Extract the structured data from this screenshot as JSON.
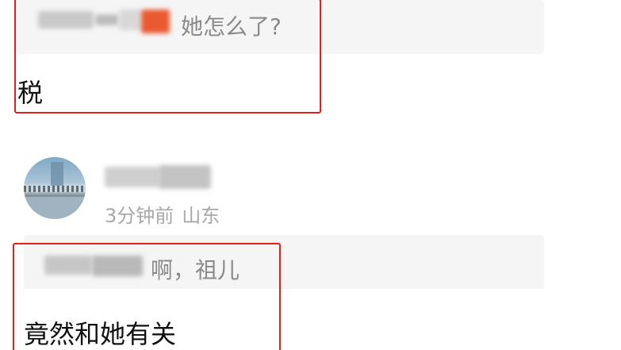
{
  "comments": [
    {
      "quote": {
        "author_name": "",
        "text": "她怎么了?"
      },
      "body": "税"
    },
    {
      "author": {
        "username": "",
        "time_ago": "3分钟前",
        "location": "山东",
        "avatar": "avatar-icon"
      },
      "quote": {
        "author_name": "",
        "text": "啊，祖儿"
      },
      "body": "竟然和她有关"
    }
  ],
  "colors": {
    "highlight": "#e0201c",
    "quote_background": "#f5f5f5",
    "secondary_text": "#a8a8a8",
    "body_text": "#111111"
  }
}
